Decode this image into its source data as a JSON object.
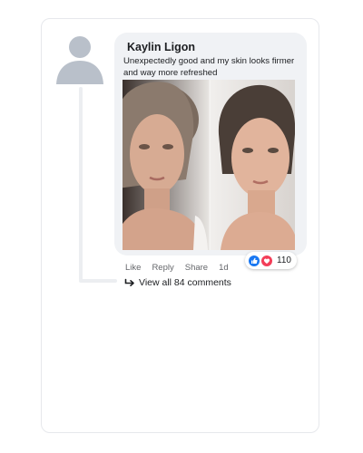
{
  "comment": {
    "author": "Kaylin Ligon",
    "text": "Unexpectedly good and my skin looks firmer and way more refreshed"
  },
  "actions": {
    "like": "Like",
    "reply": "Reply",
    "share": "Share",
    "time": "1d"
  },
  "reactions": {
    "icons": [
      "like-icon",
      "love-icon"
    ],
    "count": "110",
    "colors": {
      "like": "#1877f2",
      "love": "#f33e58"
    }
  },
  "replies": {
    "view_all": "View all 84 comments"
  }
}
